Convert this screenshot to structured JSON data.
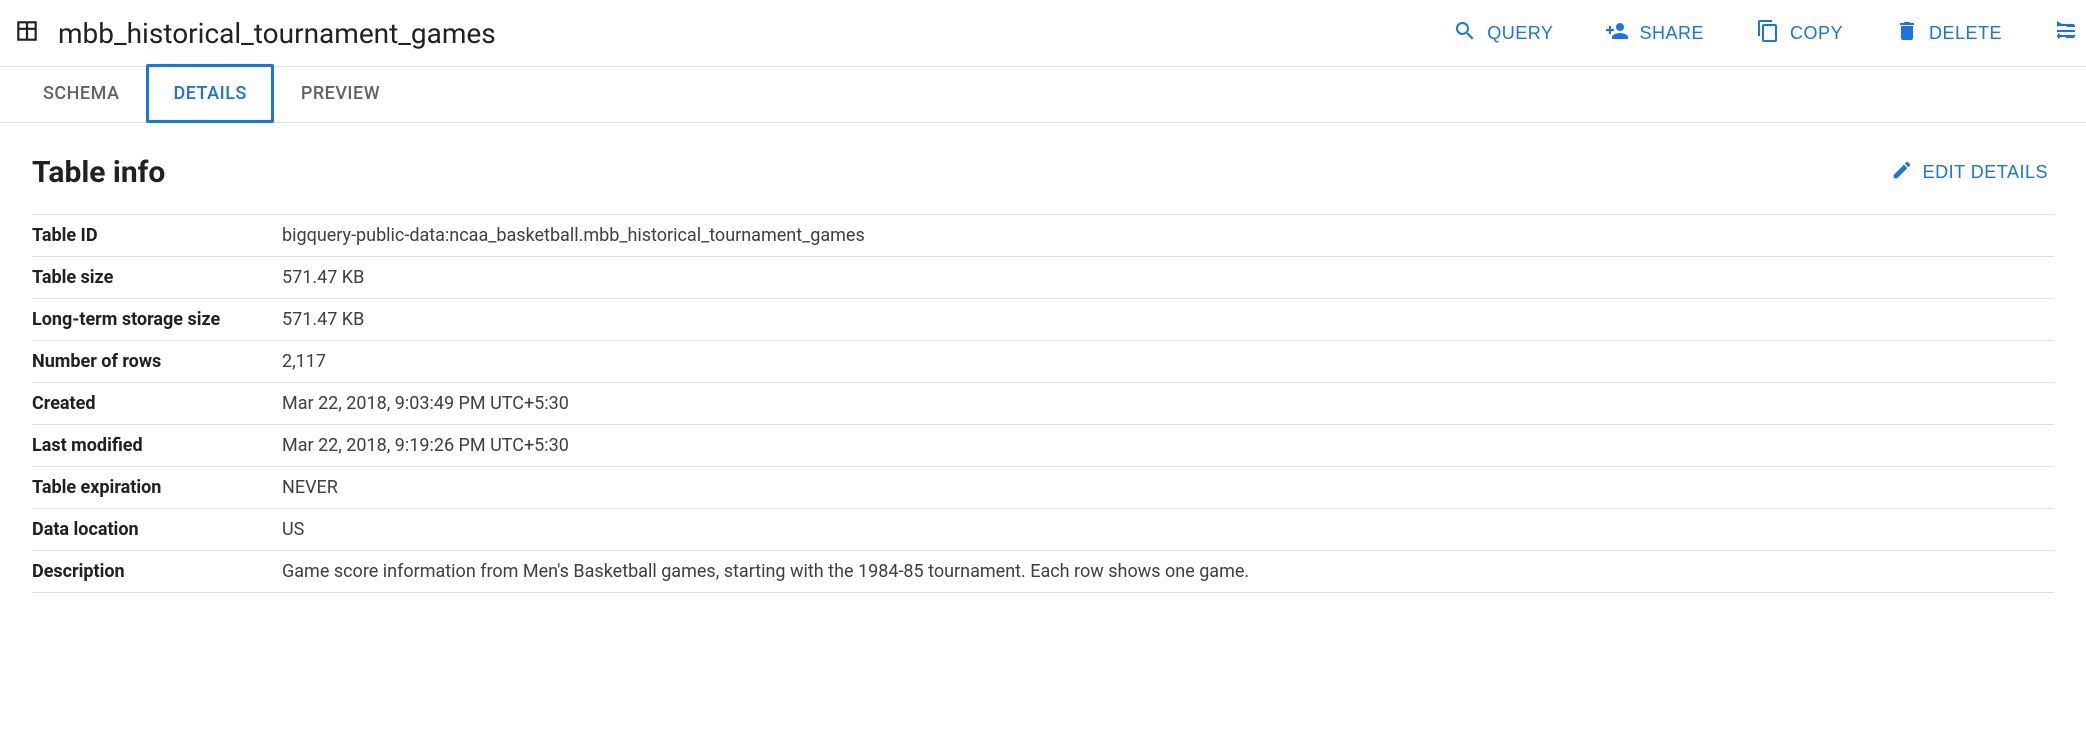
{
  "header": {
    "table_name": "mbb_historical_tournament_games",
    "actions": {
      "query": "QUERY",
      "share": "SHARE",
      "copy": "COPY",
      "delete": "DELETE"
    }
  },
  "tabs": {
    "schema": "SCHEMA",
    "details": "DETAILS",
    "preview": "PREVIEW"
  },
  "section": {
    "title": "Table info",
    "edit": "EDIT DETAILS"
  },
  "info": {
    "rows": [
      {
        "key": "Table ID",
        "value": "bigquery-public-data:ncaa_basketball.mbb_historical_tournament_games"
      },
      {
        "key": "Table size",
        "value": "571.47 KB"
      },
      {
        "key": "Long-term storage size",
        "value": "571.47 KB"
      },
      {
        "key": "Number of rows",
        "value": "2,117"
      },
      {
        "key": "Created",
        "value": "Mar 22, 2018, 9:03:49 PM UTC+5:30"
      },
      {
        "key": "Last modified",
        "value": "Mar 22, 2018, 9:19:26 PM UTC+5:30"
      },
      {
        "key": "Table expiration",
        "value": "NEVER"
      },
      {
        "key": "Data location",
        "value": "US"
      },
      {
        "key": "Description",
        "value": "Game score information from Men's Basketball games, starting with the 1984-85 tournament. Each row shows one game."
      }
    ]
  }
}
